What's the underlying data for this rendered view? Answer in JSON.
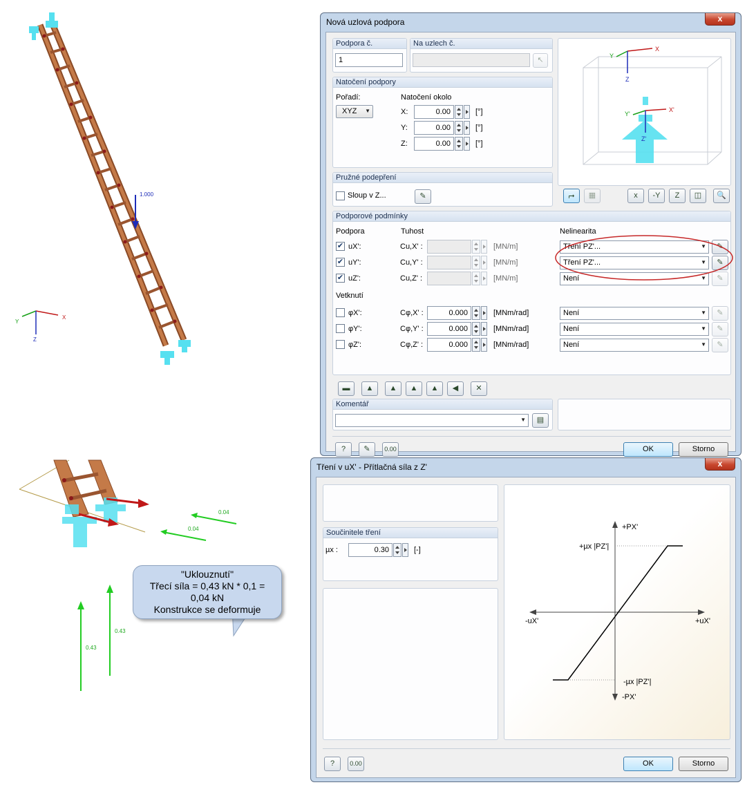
{
  "scene_top": {
    "load_value": "1.000",
    "axes": {
      "x": "X",
      "y": "Y",
      "z": "Z"
    }
  },
  "scene_bottom": {
    "friction_values": [
      "0.04",
      "0.04"
    ],
    "normal_values": [
      "0.43",
      "0.43"
    ],
    "callout_lines": [
      "\"Uklouznutí\"",
      "Třecí síla = 0,43 kN * 0,1 =",
      "0,04 kN",
      "Konstrukce se deformuje"
    ]
  },
  "dialog1": {
    "title": "Nová uzlová podpora",
    "close": "x",
    "support_no_label": "Podpora č.",
    "support_no_value": "1",
    "nodes_label": "Na uzlech č.",
    "nodes_value": "",
    "rotation": {
      "header": "Natočení podpory",
      "order_label": "Pořadí:",
      "order_value": "XYZ",
      "about_label": "Natočení okolo",
      "rows": [
        {
          "axis": "X:",
          "value": "0.00",
          "unit": "[°]"
        },
        {
          "axis": "Y:",
          "value": "0.00",
          "unit": "[°]"
        },
        {
          "axis": "Z:",
          "value": "0.00",
          "unit": "[°]"
        }
      ]
    },
    "elastic": {
      "header": "Pružné podepření",
      "column_label": "Sloup v Z..."
    },
    "preview_axes": {
      "x": "X",
      "y": "Y",
      "z": "Z",
      "xp": "X'",
      "yp": "Y'",
      "zp": "Z'"
    },
    "preview_buttons": [
      "⮣",
      "▦",
      "x",
      "-Y",
      "Z",
      "◫",
      "🔍"
    ],
    "conditions": {
      "header": "Podporové podmínky",
      "support_col": "Podpora",
      "stiffness_col": "Tuhost",
      "nonlinear_col": "Nelinearita",
      "translation_rows": [
        {
          "label": "uX':",
          "cl": "Cu,X' :",
          "value": "",
          "unit": "[MN/m]",
          "nonlin": "Tření PZ'...",
          "checked": "✔"
        },
        {
          "label": "uY':",
          "cl": "Cu,Y' :",
          "value": "",
          "unit": "[MN/m]",
          "nonlin": "Tření PZ'...",
          "checked": "✔"
        },
        {
          "label": "uZ':",
          "cl": "Cu,Z' :",
          "value": "",
          "unit": "[MN/m]",
          "nonlin": "Není",
          "checked": "✔"
        }
      ],
      "fixity_label": "Vetknutí",
      "rotation_rows": [
        {
          "label": "φX':",
          "cl": "Cφ,X' :",
          "value": "0.000",
          "unit": "[MNm/rad]",
          "nonlin": "Není"
        },
        {
          "label": "φY':",
          "cl": "Cφ,Y' :",
          "value": "0.000",
          "unit": "[MNm/rad]",
          "nonlin": "Není"
        },
        {
          "label": "φZ':",
          "cl": "Cφ,Z' :",
          "value": "0.000",
          "unit": "[MNm/rad]",
          "nonlin": "Není"
        }
      ]
    },
    "comment": {
      "header": "Komentář",
      "value": ""
    },
    "ok": "OK",
    "cancel": "Storno"
  },
  "dialog2": {
    "title": "Tření v uX' - Přítlačná síla z Z'",
    "close": "x",
    "friction_header": "Součinitele tření",
    "mu_label": "µx :",
    "mu_value": "0.30",
    "mu_unit": "[-]",
    "chart_labels": {
      "p_pos": "+PX'",
      "p_neg": "-PX'",
      "u_pos": "+uX'",
      "u_neg": "-uX'",
      "mu_pos": "+µx |PZ'|",
      "mu_neg": "-µx |PZ'|"
    },
    "ok": "OK",
    "cancel": "Storno"
  },
  "colors": {
    "ladder": "#b86a3c",
    "support": "#54e4f2",
    "force_green": "#22cc22",
    "force_red": "#c01818",
    "load_blue": "#1d2cb8",
    "highlight": "#c62828"
  }
}
